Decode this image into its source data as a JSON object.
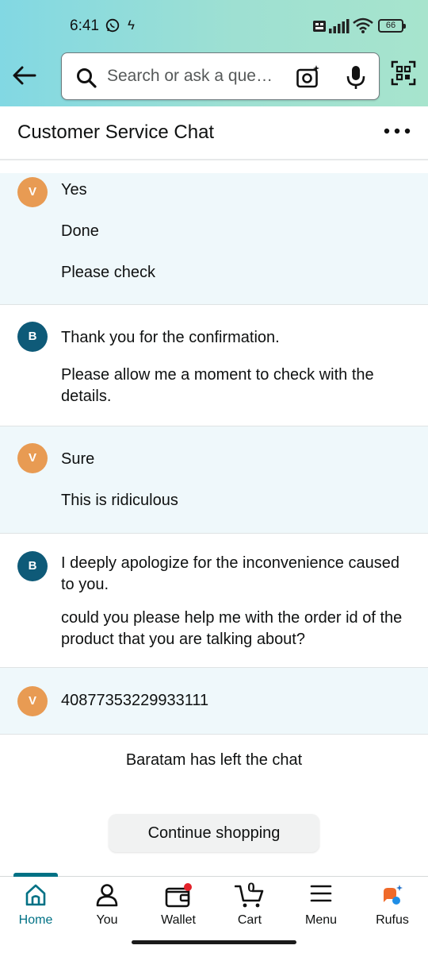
{
  "status_bar": {
    "time": "6:41",
    "battery": "66",
    "network": "Vo LTE"
  },
  "header": {
    "search_placeholder": "Search or ask a que…"
  },
  "title_bar": {
    "title": "Customer Service Chat"
  },
  "messages": [
    {
      "sender_initial": "V",
      "sender": "customer",
      "lines": [
        "Yes",
        "Done",
        "Please check"
      ]
    },
    {
      "sender_initial": "B",
      "sender": "agent",
      "lines": [
        "Thank you for the confirmation.",
        "Please allow me a moment to check with the details."
      ]
    },
    {
      "sender_initial": "V",
      "sender": "customer",
      "lines": [
        "Sure",
        "This is ridiculous"
      ]
    },
    {
      "sender_initial": "B",
      "sender": "agent",
      "lines": [
        "I deeply apologize for the inconvenience caused to you.",
        "could you please help me with the order id of the product that you are talking about?"
      ]
    },
    {
      "sender_initial": "V",
      "sender": "customer",
      "lines": [
        "40877353229933111"
      ]
    }
  ],
  "system_note": "Baratam has left the chat",
  "continue_button": "Continue shopping",
  "bottom_nav": [
    {
      "label": "Home",
      "icon": "home-icon",
      "active": true
    },
    {
      "label": "You",
      "icon": "user-icon",
      "active": false
    },
    {
      "label": "Wallet",
      "icon": "wallet-icon",
      "active": false
    },
    {
      "label": "Cart",
      "icon": "cart-icon",
      "active": false,
      "count": "0"
    },
    {
      "label": "Menu",
      "icon": "menu-icon",
      "active": false
    },
    {
      "label": "Rufus",
      "icon": "rufus-icon",
      "active": false
    }
  ],
  "colors": {
    "accent": "#007185",
    "customer_avatar": "#e89b53",
    "agent_avatar": "#0e5a78",
    "customer_bg": "#eff8fb",
    "notification_dot": "#e3222a"
  }
}
